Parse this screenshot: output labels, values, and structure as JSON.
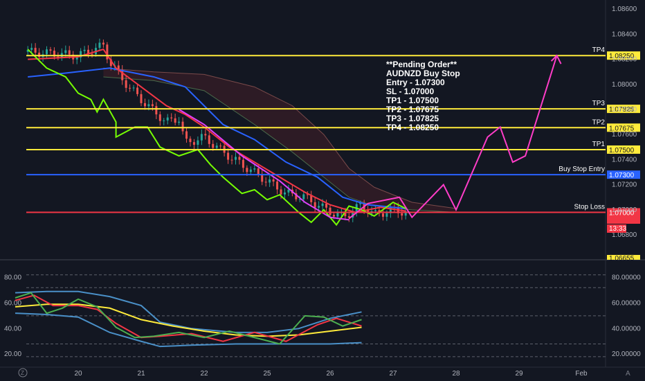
{
  "chart_data": {
    "type": "line",
    "symbol": "AUDNZD",
    "annotation_lines": [
      "**Pending Order**",
      "AUDNZD Buy Stop",
      "Entry - 1.07300",
      "SL - 1.07000",
      "TP1 - 1.07500",
      "TP2 - 1.07675",
      "TP3 - 1.07825",
      "TP4 - 1.08250"
    ],
    "x_tick_labels": [
      "20",
      "21",
      "22",
      "25",
      "26",
      "27",
      "28",
      "29",
      "Feb"
    ],
    "price_axis": {
      "ylim": [
        1.0666,
        1.0866
      ],
      "ticks": [
        1.0682,
        1.0702,
        1.0722,
        1.0742,
        1.0762,
        1.0782,
        1.0802,
        1.0822,
        1.0842,
        1.0862
      ],
      "tick_labels": [
        "1.06800",
        "1.07000",
        "1.07200",
        "1.07400",
        "1.07600",
        "1.07800",
        "1.08000",
        "1.08200",
        "1.08400",
        "1.08600"
      ]
    },
    "levels": [
      {
        "name": "TP4",
        "value": 1.0825,
        "label": "1.08250",
        "color": "#ffeb3b"
      },
      {
        "name": "TP3",
        "value": 1.07825,
        "label": "1.07825",
        "color": "#ffeb3b"
      },
      {
        "name": "TP2",
        "value": 1.07675,
        "label": "1.07675",
        "color": "#ffeb3b"
      },
      {
        "name": "TP1",
        "value": 1.075,
        "label": "1.07500",
        "color": "#ffeb3b"
      },
      {
        "name": "Buy Stop Entry",
        "value": 1.073,
        "label": "1.07300",
        "color": "#2962ff"
      },
      {
        "name": "Stop Loss",
        "value": 1.07,
        "label": "1.07000",
        "color": "#f23645"
      }
    ],
    "timer_label": "13:33",
    "bottom_cut_label": "1.06655",
    "oscillator": {
      "left_ticks": [
        20,
        40,
        60,
        80
      ],
      "left_tick_labels": [
        "20.00",
        "40.00",
        "60.00",
        "80.00"
      ],
      "right_ticks": [
        20,
        40,
        60,
        80
      ],
      "right_tick_labels": [
        "20.00000",
        "40.00000",
        "60.00000",
        "80.00000"
      ],
      "ylim": [
        12,
        90
      ],
      "dashed_levels": [
        18,
        28,
        50,
        72,
        82
      ],
      "series": [
        {
          "color": "#4a90c8",
          "x": [
            0,
            0.5,
            1,
            1.5,
            2,
            2.3,
            2.8,
            3.5,
            4,
            4.5,
            5,
            5.5
          ],
          "values": [
            68,
            69,
            69,
            65,
            58,
            45,
            40,
            37,
            37,
            40,
            48,
            53
          ]
        },
        {
          "color": "#4a90c8",
          "x": [
            0,
            0.5,
            1,
            1.5,
            2,
            2.3,
            2.8,
            3.5,
            4,
            4.5,
            5,
            5.5
          ],
          "values": [
            52,
            51,
            49,
            37,
            30,
            26,
            27,
            28,
            28,
            28,
            28,
            29
          ]
        },
        {
          "color": "#ffeb3b",
          "x": [
            0,
            0.5,
            1,
            1.5,
            2,
            2.5,
            3,
            3.5,
            4,
            4.5,
            5,
            5.5
          ],
          "values": [
            57,
            59,
            59,
            56,
            47,
            42,
            38,
            35,
            34,
            35,
            38,
            41
          ]
        },
        {
          "color": "#f23645",
          "x": [
            0,
            0.3,
            0.6,
            1,
            1.3,
            1.6,
            2,
            2.3,
            2.8,
            3.3,
            3.8,
            4.3,
            4.8,
            5.1,
            5.5
          ],
          "values": [
            62,
            66,
            58,
            58,
            55,
            44,
            33,
            34,
            36,
            30,
            37,
            30,
            43,
            48,
            42
          ]
        },
        {
          "color": "#4caf50",
          "x": [
            0,
            0.25,
            0.5,
            0.75,
            1,
            1.3,
            1.6,
            1.9,
            2.2,
            2.6,
            3,
            3.4,
            3.8,
            4.2,
            4.6,
            4.9,
            5.2,
            5.5
          ],
          "values": [
            64,
            68,
            52,
            56,
            63,
            57,
            41,
            33,
            34,
            37,
            33,
            38,
            33,
            28,
            50,
            49,
            42,
            47
          ]
        }
      ]
    }
  }
}
